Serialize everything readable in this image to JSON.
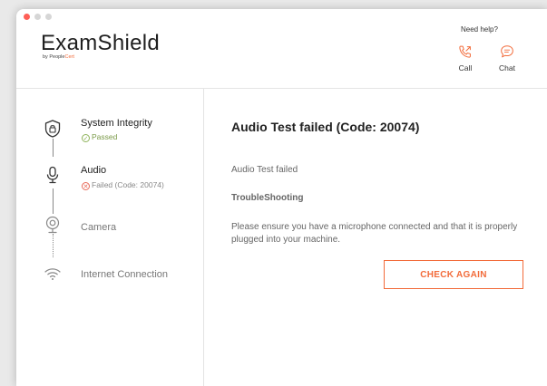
{
  "app": {
    "name": "ExamShield",
    "byline_prefix": "by People",
    "byline_brand": "Cert"
  },
  "help": {
    "label": "Need help?",
    "call_label": "Call",
    "chat_label": "Chat"
  },
  "steps": [
    {
      "title": "System Integrity",
      "status": "Passed",
      "state": "passed",
      "icon": "shield-lock-icon"
    },
    {
      "title": "Audio",
      "status": "Failed (Code: 20074)",
      "state": "failed",
      "icon": "microphone-icon"
    },
    {
      "title": "Camera",
      "status": "",
      "state": "pending",
      "icon": "webcam-icon"
    },
    {
      "title": "Internet Connection",
      "status": "",
      "state": "pending",
      "icon": "wifi-icon"
    }
  ],
  "main": {
    "title": "Audio Test failed (Code: 20074)",
    "subtitle": "Audio Test failed",
    "troubleshooting_label": "TroubleShooting",
    "message": "Please ensure you have a microphone connected and that it is properly plugged into your machine.",
    "button_label": "CHECK AGAIN"
  },
  "colors": {
    "accent": "#f26b3a",
    "pass": "#8fb35a",
    "fail": "#e86b5a"
  }
}
